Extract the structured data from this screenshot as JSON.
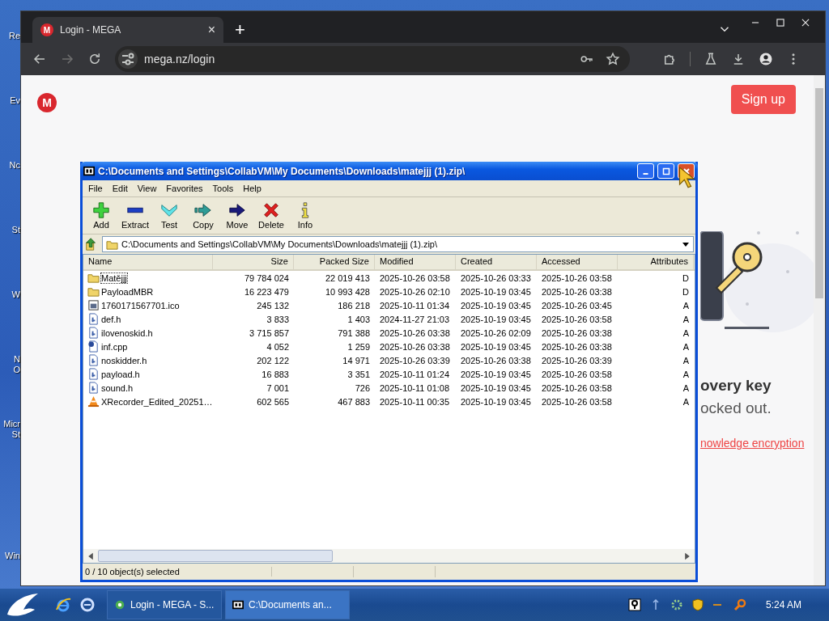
{
  "desktop": {
    "icon_labels": [
      "Re",
      "Ev",
      "Nc",
      "St",
      "W",
      "N\nO",
      "Micr\nSt",
      "Win"
    ]
  },
  "browser": {
    "tab": {
      "favicon_letter": "M",
      "title": "Login - MEGA",
      "close": "×",
      "selected": true
    },
    "new_tab": "+",
    "url": "mega.nz/login",
    "page": {
      "logo_letter": "M",
      "signup": "Sign up",
      "partial_heading": "overy key",
      "partial_text": "ocked out.",
      "partial_link": "nowledge encryption"
    }
  },
  "archive_window": {
    "title": "C:\\Documents and Settings\\CollabVM\\My Documents\\Downloads\\matejjj (1).zip\\",
    "menu": [
      "File",
      "Edit",
      "View",
      "Favorites",
      "Tools",
      "Help"
    ],
    "toolbar": [
      {
        "label": "Add",
        "kind": "add"
      },
      {
        "label": "Extract",
        "kind": "extract"
      },
      {
        "label": "Test",
        "kind": "test"
      },
      {
        "label": "Copy",
        "kind": "copy"
      },
      {
        "label": "Move",
        "kind": "move"
      },
      {
        "label": "Delete",
        "kind": "delete"
      },
      {
        "label": "Info",
        "kind": "info"
      }
    ],
    "path": "C:\\Documents and Settings\\CollabVM\\My Documents\\Downloads\\matejjj (1).zip\\",
    "columns": [
      "Name",
      "Size",
      "Packed Size",
      "Modified",
      "Created",
      "Accessed",
      "Attributes"
    ],
    "rows": [
      {
        "kind": "folder",
        "focused": true,
        "cells": [
          "Matějjj",
          "79 784 024",
          "22 019 413",
          "2025-10-26 03:58",
          "2025-10-26 03:33",
          "2025-10-26 03:58",
          "D"
        ]
      },
      {
        "kind": "folder",
        "focused": false,
        "cells": [
          "PayloadMBR",
          "16 223 479",
          "10 993 428",
          "2025-10-26 02:10",
          "2025-10-19 03:45",
          "2025-10-26 03:38",
          "D"
        ]
      },
      {
        "kind": "image",
        "focused": false,
        "cells": [
          "1760171567701.ico",
          "245 132",
          "186 218",
          "2025-10-11 01:34",
          "2025-10-19 03:45",
          "2025-10-26 03:45",
          "A"
        ]
      },
      {
        "kind": "header",
        "focused": false,
        "cells": [
          "def.h",
          "3 833",
          "1 403",
          "2024-11-27 21:03",
          "2025-10-19 03:45",
          "2025-10-26 03:58",
          "A"
        ]
      },
      {
        "kind": "header",
        "focused": false,
        "cells": [
          "ilovenoskid.h",
          "3 715 857",
          "791 388",
          "2025-10-26 03:38",
          "2025-10-26 02:09",
          "2025-10-26 03:38",
          "A"
        ]
      },
      {
        "kind": "source",
        "focused": false,
        "cells": [
          "inf.cpp",
          "4 052",
          "1 259",
          "2025-10-26 03:38",
          "2025-10-19 03:45",
          "2025-10-26 03:38",
          "A"
        ]
      },
      {
        "kind": "header",
        "focused": false,
        "cells": [
          "noskidder.h",
          "202 122",
          "14 971",
          "2025-10-26 03:39",
          "2025-10-26 03:38",
          "2025-10-26 03:39",
          "A"
        ]
      },
      {
        "kind": "header",
        "focused": false,
        "cells": [
          "payload.h",
          "16 883",
          "3 351",
          "2025-10-11 01:24",
          "2025-10-19 03:45",
          "2025-10-26 03:58",
          "A"
        ]
      },
      {
        "kind": "header",
        "focused": false,
        "cells": [
          "sound.h",
          "7 001",
          "726",
          "2025-10-11 01:08",
          "2025-10-19 03:45",
          "2025-10-26 03:58",
          "A"
        ]
      },
      {
        "kind": "video",
        "focused": false,
        "cells": [
          "XRecorder_Edited_20251…",
          "602 565",
          "467 883",
          "2025-10-11 00:35",
          "2025-10-19 03:45",
          "2025-10-26 03:58",
          "A"
        ]
      }
    ],
    "status": "0 / 10 object(s) selected"
  },
  "taskbar": {
    "tasks": [
      {
        "label": "Login - MEGA - S...",
        "kind": "browser",
        "selected": false
      },
      {
        "label": "C:\\Documents an...",
        "kind": "archive",
        "selected": true
      }
    ],
    "clock": "5:24 AM"
  }
}
